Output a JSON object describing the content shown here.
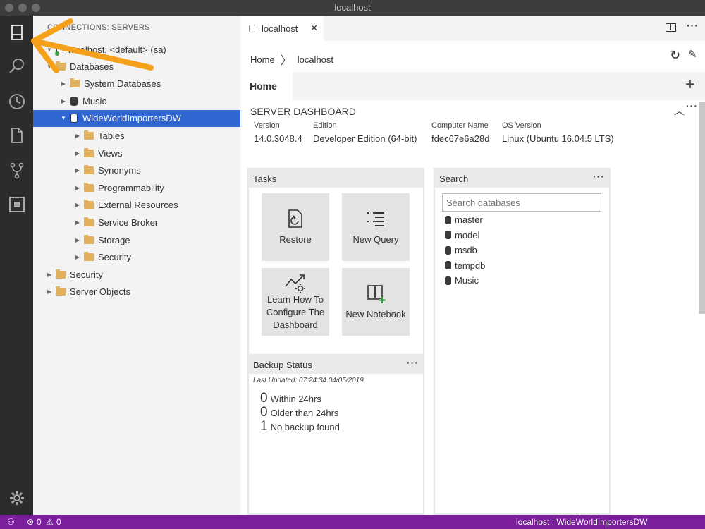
{
  "window": {
    "title": "localhost"
  },
  "sidebar": {
    "header": "CONNECTIONS: SERVERS",
    "server": "localhost, <default> (sa)",
    "tree": [
      {
        "label": "Databases",
        "indent": 1,
        "kind": "folder",
        "twisty": "▼"
      },
      {
        "label": "System Databases",
        "indent": 2,
        "kind": "folder",
        "twisty": "▶"
      },
      {
        "label": "Music",
        "indent": 2,
        "kind": "db",
        "twisty": "▶"
      },
      {
        "label": "WideWorldImportersDW",
        "indent": 2,
        "kind": "db",
        "twisty": "▼",
        "selected": true
      },
      {
        "label": "Tables",
        "indent": 3,
        "kind": "folder",
        "twisty": "▶"
      },
      {
        "label": "Views",
        "indent": 3,
        "kind": "folder",
        "twisty": "▶"
      },
      {
        "label": "Synonyms",
        "indent": 3,
        "kind": "folder",
        "twisty": "▶"
      },
      {
        "label": "Programmability",
        "indent": 3,
        "kind": "folder",
        "twisty": "▶"
      },
      {
        "label": "External Resources",
        "indent": 3,
        "kind": "folder",
        "twisty": "▶"
      },
      {
        "label": "Service Broker",
        "indent": 3,
        "kind": "folder",
        "twisty": "▶"
      },
      {
        "label": "Storage",
        "indent": 3,
        "kind": "folder",
        "twisty": "▶"
      },
      {
        "label": "Security",
        "indent": 3,
        "kind": "folder",
        "twisty": "▶"
      },
      {
        "label": "Security",
        "indent": 1,
        "kind": "folder",
        "twisty": "▶"
      },
      {
        "label": "Server Objects",
        "indent": 1,
        "kind": "folder",
        "twisty": "▶"
      }
    ]
  },
  "editor": {
    "tab_label": "localhost",
    "tab_close": "✕",
    "breadcrumb": {
      "home": "Home",
      "server": "localhost"
    },
    "home_tab": "Home",
    "dashboard_title": "SERVER DASHBOARD",
    "properties": [
      {
        "label": "Version",
        "value": "14.0.3048.4"
      },
      {
        "label": "Edition",
        "value": "Developer Edition (64-bit)"
      },
      {
        "label": "Computer Name",
        "value": "fdec67e6a28d"
      },
      {
        "label": "OS Version",
        "value": "Linux (Ubuntu 16.04.5 LTS)"
      }
    ]
  },
  "tasks": {
    "title": "Tasks",
    "items": [
      {
        "label": "Restore"
      },
      {
        "label": "New Query"
      },
      {
        "label": "Learn How To Configure The Dashboard"
      },
      {
        "label": "New Notebook"
      }
    ]
  },
  "search": {
    "title": "Search",
    "placeholder": "Search databases",
    "databases": [
      "master",
      "model",
      "msdb",
      "tempdb",
      "Music"
    ]
  },
  "backup": {
    "title": "Backup Status",
    "last_updated": "Last Updated: 07:24:34 04/05/2019",
    "rows": [
      {
        "count": "0",
        "label": "Within 24hrs"
      },
      {
        "count": "0",
        "label": "Older than 24hrs"
      },
      {
        "count": "1",
        "label": "No backup found"
      }
    ]
  },
  "statusbar": {
    "errors": "0",
    "warnings": "0",
    "connection": "localhost : WideWorldImportersDW"
  },
  "colors": {
    "accent": "#2f66d2",
    "statusbar": "#7a1e9c",
    "arrow": "#f5a01a",
    "folder": "#e0b15e"
  }
}
